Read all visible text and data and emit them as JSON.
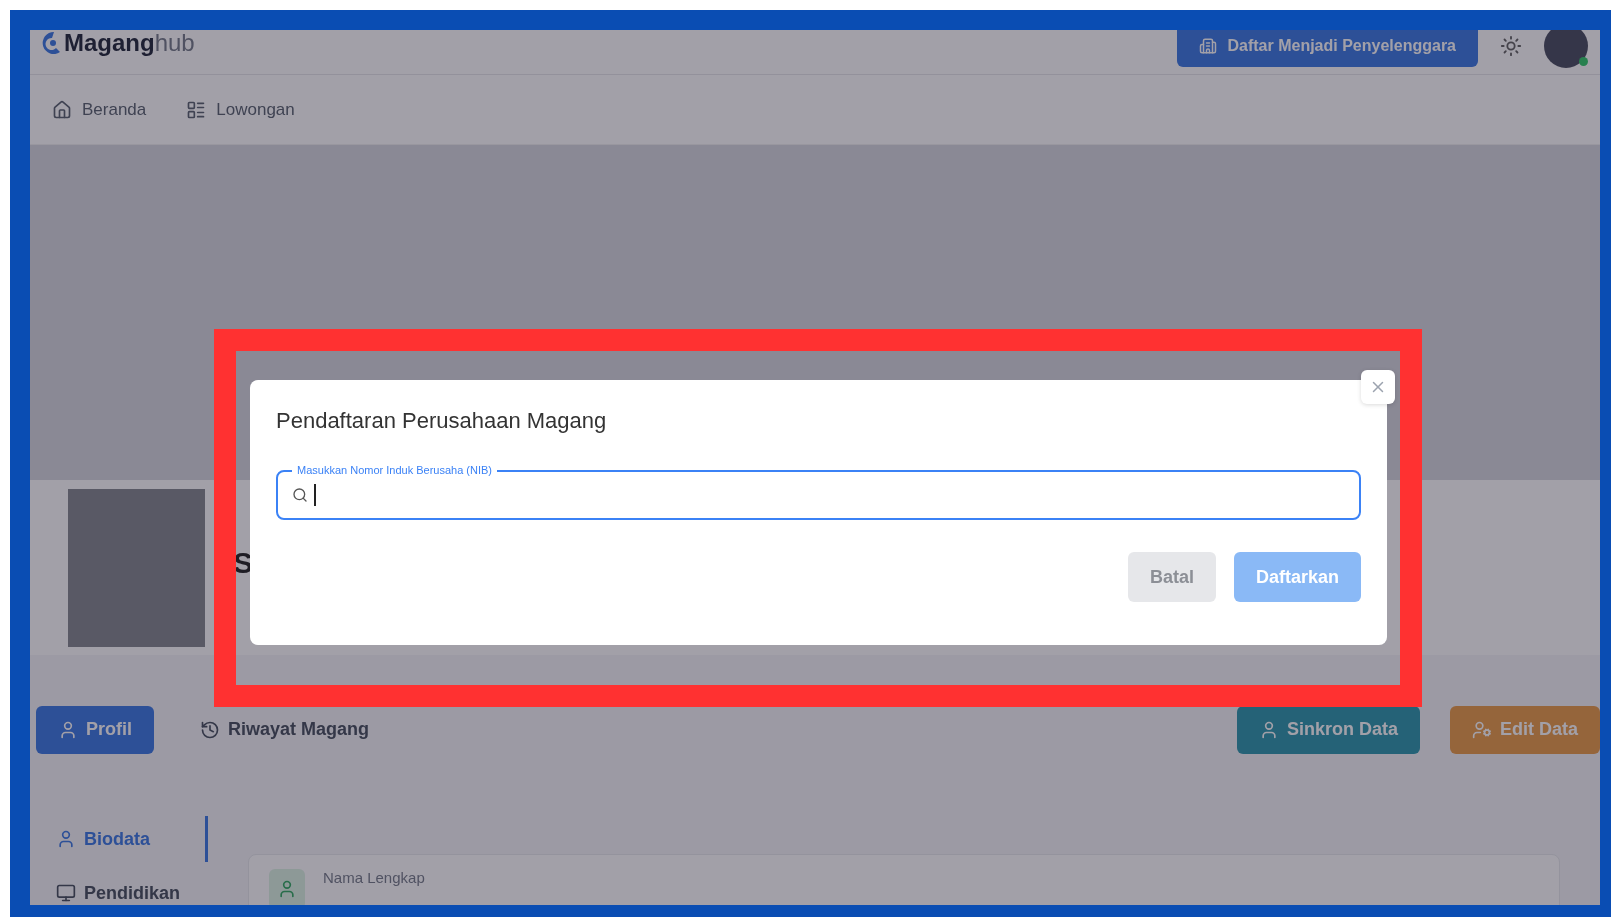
{
  "header": {
    "logo_bold": "Magang",
    "logo_light": "hub",
    "register_button": "Daftar Menjadi Penyelenggara"
  },
  "nav": [
    {
      "label": "Beranda",
      "kind": "home"
    },
    {
      "label": "Lowongan",
      "kind": "list"
    }
  ],
  "profile": {
    "name": "S"
  },
  "tabs": [
    {
      "label": "Profil",
      "selected": true
    },
    {
      "label": "Riwayat Magang",
      "selected": false
    }
  ],
  "actions": [
    {
      "label": "Sinkron Data",
      "kind": "sync"
    },
    {
      "label": "Edit Data",
      "kind": "edit"
    }
  ],
  "sidebar": [
    {
      "label": "Biodata",
      "kind": "person",
      "selected": true
    },
    {
      "label": "Pendidikan",
      "kind": "screen",
      "selected": false
    }
  ],
  "fields": [
    {
      "label": "Nama Lengkap"
    }
  ],
  "modal": {
    "title": "Pendaftaran Perusahaan Magang",
    "input_label": "Masukkan Nomor Induk Berusaha (NIB)",
    "focused": true,
    "buttons": [
      {
        "label": "Batal",
        "kind": "cancel"
      },
      {
        "label": "Daftarkan",
        "kind": "primary"
      }
    ]
  }
}
